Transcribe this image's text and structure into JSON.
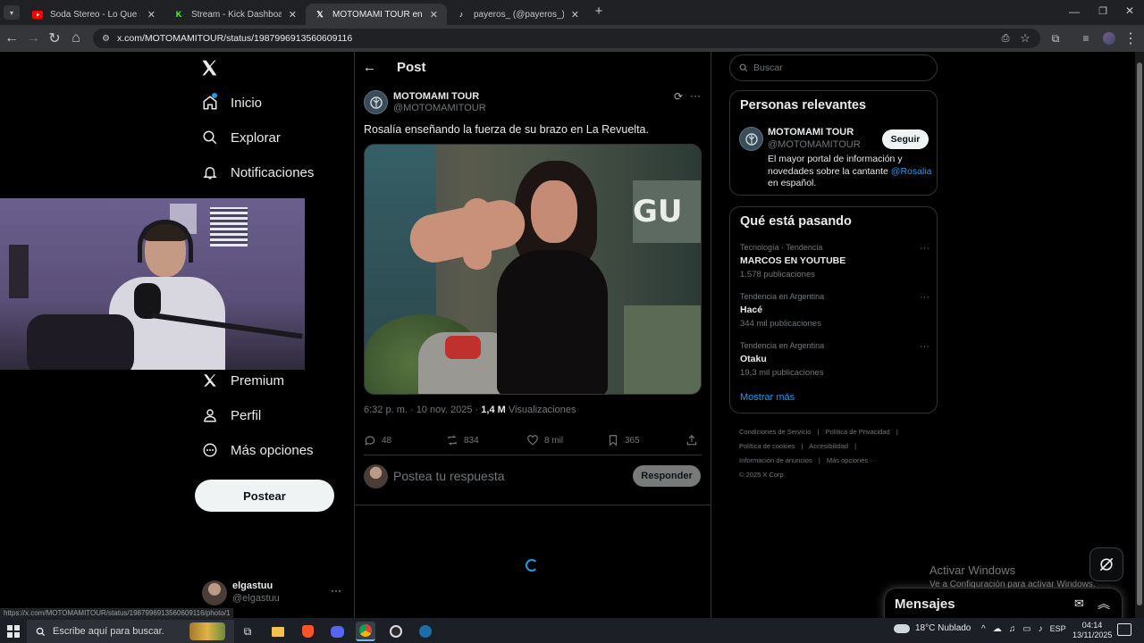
{
  "browser": {
    "tabs": [
      {
        "title": "Soda Stereo - Lo Que Sangra (l...",
        "favicon": "youtube-icon"
      },
      {
        "title": "Stream - Kick Dashboard",
        "favicon": "kick-icon"
      },
      {
        "title": "MOTOMAMI TOUR en X: \"Rosal...",
        "favicon": "x-icon",
        "active": true
      },
      {
        "title": "payeros_ (@payeros_) | TikTok",
        "favicon": "tiktok-icon"
      }
    ],
    "url": "x.com/MOTOMAMITOUR/status/1987996913560609116",
    "status_url": "https://x.com/MOTOMAMITOUR/status/1987996913560609116/photo/1"
  },
  "nav": {
    "items": [
      {
        "label": "Inicio",
        "icon": "home-icon"
      },
      {
        "label": "Explorar",
        "icon": "search-icon"
      },
      {
        "label": "Notificaciones",
        "icon": "bell-icon"
      },
      {
        "label": "Premium",
        "icon": "x-logo-icon"
      },
      {
        "label": "Perfil",
        "icon": "person-icon"
      },
      {
        "label": "Más opciones",
        "icon": "more-circle-icon"
      }
    ],
    "post_button": "Postear",
    "account": {
      "name": "elgastuu",
      "handle": "@elgastuu"
    }
  },
  "post": {
    "header": "Post",
    "author": "MOTOMAMI TOUR",
    "handle": "@MOTOMAMITOUR",
    "text": "Rosalía enseñando la fuerza de su brazo en La Revuelta.",
    "meta_time": "6:32 p. m. · 10 nov. 2025 · ",
    "views_count": "1,4 M",
    "views_label": " Visualizaciones",
    "stats": {
      "replies": "48",
      "reposts": "834",
      "likes": "8 mil",
      "bookmarks": "365"
    },
    "reply_placeholder": "Postea tu respuesta",
    "reply_button": "Responder"
  },
  "sidebar": {
    "search_placeholder": "Buscar",
    "relevant": {
      "title": "Personas relevantes",
      "name": "MOTOMAMI TOUR",
      "handle": "@MOTOMAMITOUR",
      "follow": "Seguir",
      "bio_pre": "El mayor portal de información y novedades sobre la cantante ",
      "bio_link": "@Rosalia",
      "bio_post": " en español."
    },
    "trends": {
      "title": "Qué está pasando",
      "items": [
        {
          "context": "Tecnología · Tendencia",
          "name": "MARCOS EN YOUTUBE",
          "count": "1.578 publicaciones"
        },
        {
          "context": "Tendencia en Argentina",
          "name": "Hacé",
          "count": "344 mil publicaciones"
        },
        {
          "context": "Tendencia en Argentina",
          "name": "Otaku",
          "count": "19,3 mil publicaciones"
        }
      ],
      "more": "Mostrar más"
    },
    "footer": {
      "links": [
        "Condiciones de Servicio",
        "Política de Privacidad",
        "Política de cookies",
        "Accesibilidad",
        "Información de anuncios",
        "Más opciones ···"
      ],
      "copyright": "© 2025 X Corp."
    },
    "messages": "Mensajes"
  },
  "watermark": {
    "line1": "Activar Windows",
    "line2": "Ve a Configuración para activar Windows."
  },
  "taskbar": {
    "search_placeholder": "Escribe aquí para buscar.",
    "weather": "18°C  Nublado",
    "lang": "ESP",
    "time": "04:14",
    "date": "13/11/2025"
  }
}
